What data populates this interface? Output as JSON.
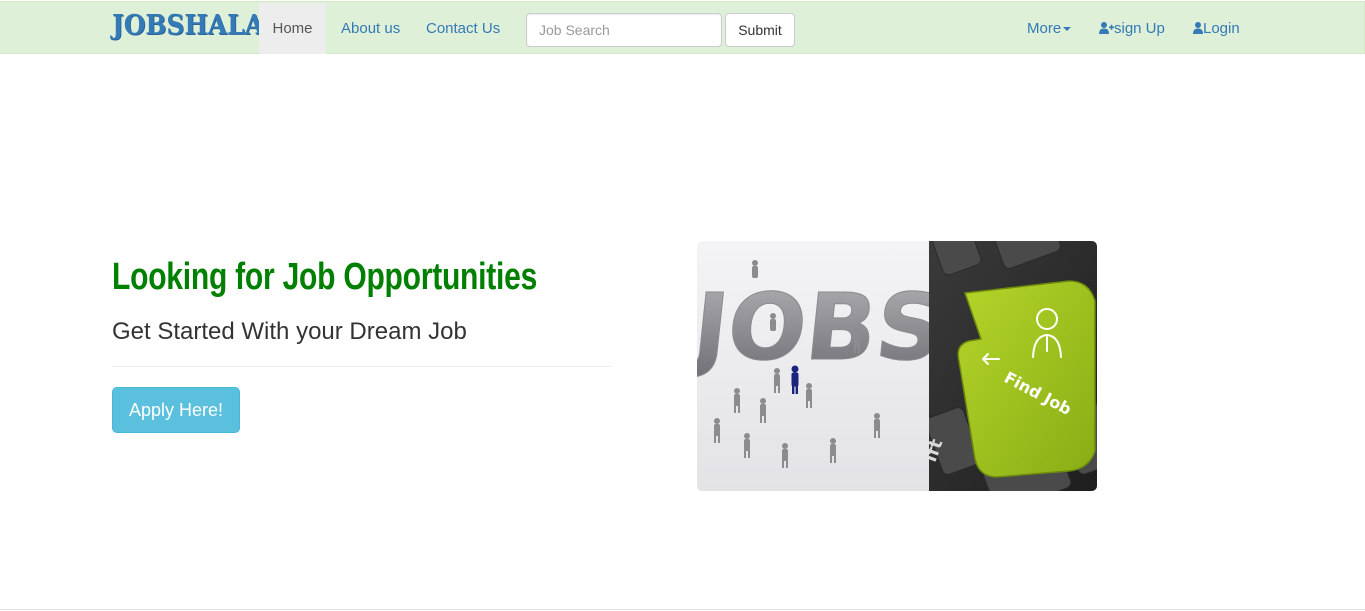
{
  "navbar": {
    "brand": "JOBSHALA",
    "links": [
      {
        "label": "Home",
        "active": true
      },
      {
        "label": "About us"
      },
      {
        "label": "Contact Us"
      }
    ],
    "search": {
      "placeholder": "Job Search",
      "value": ""
    },
    "submit_label": "Submit",
    "more_label": "More",
    "signup_label": "sign Up",
    "login_label": "Login"
  },
  "hero": {
    "title": "Looking for Job Opportunities",
    "subtitle": "Get Started With your Dream Job",
    "apply_label": "Apply Here!",
    "image_left_text": "JOBS",
    "image_key_text": "Find Job",
    "image_key_side_text": "ift"
  },
  "colors": {
    "navbar_bg": "#dff0d8",
    "link": "#337ab7",
    "title": "#008000",
    "apply_btn": "#5bc0de",
    "key_green": "#9fc31f"
  },
  "icons": {
    "signup": "user-plus-icon",
    "login": "user-icon",
    "more": "caret-down-icon"
  }
}
